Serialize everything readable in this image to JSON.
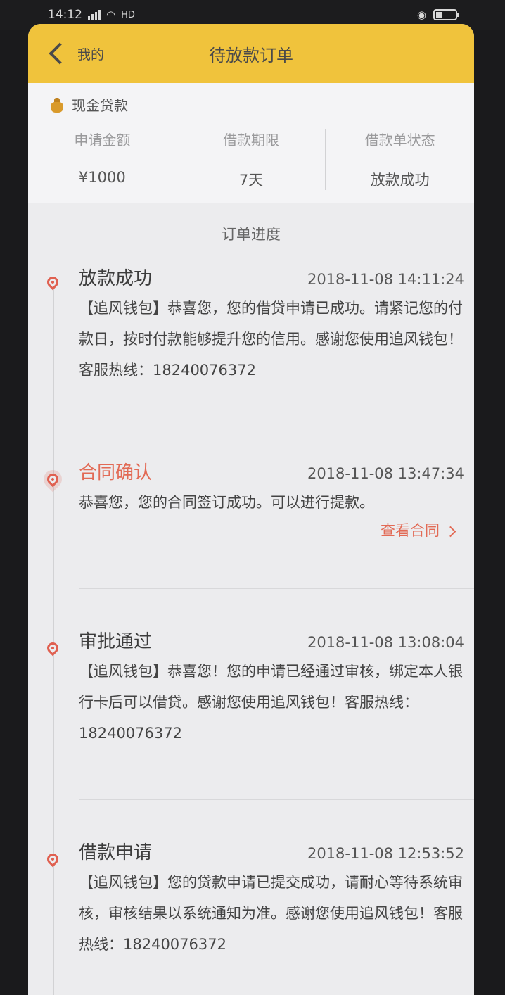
{
  "status_bar": {
    "time": "14:12",
    "signal_text": "ill",
    "wifi": "wifi-icon",
    "hd": "HD"
  },
  "nav": {
    "back_label": "我的",
    "title": "待放款订单"
  },
  "summary": {
    "title": "现金贷款",
    "columns": [
      {
        "label": "申请金额",
        "value": "¥1000"
      },
      {
        "label": "借款期限",
        "value": "7天"
      },
      {
        "label": "借款单状态",
        "value": "放款成功"
      }
    ]
  },
  "progress": {
    "title": "订单进度"
  },
  "events": [
    {
      "title": "放款成功",
      "time": "2018-11-08 14:11:24",
      "body": "【追风钱包】恭喜您，您的借贷申请已成功。请紧记您的付款日，按时付款能够提升您的信用。感谢您使用追风钱包！客服热线：18240076372"
    },
    {
      "title": "合同确认",
      "time": "2018-11-08 13:47:34",
      "body": "恭喜您，您的合同签订成功。可以进行提款。",
      "link": "查看合同"
    },
    {
      "title": "审批通过",
      "time": "2018-11-08 13:08:04",
      "body": "【追风钱包】恭喜您！您的申请已经通过审核，绑定本人银行卡后可以借贷。感谢您使用追风钱包！客服热线：18240076372"
    },
    {
      "title": "借款申请",
      "time": "2018-11-08 12:53:52",
      "body": "【追风钱包】您的贷款申请已提交成功，请耐心等待系统审核，审核结果以系统通知为准。感谢您使用追风钱包！客服热线：18240076372"
    }
  ],
  "colors": {
    "nav_bg": "#f0c33c",
    "accent": "#e26a55",
    "icon": "#e06050"
  }
}
